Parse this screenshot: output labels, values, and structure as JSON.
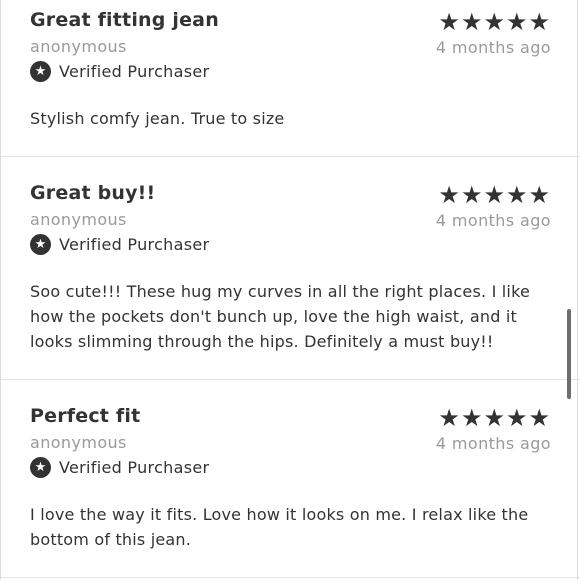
{
  "reviews": [
    {
      "title": "Great fitting jean",
      "stars": "★★★★★",
      "rating": 5,
      "author": "anonymous",
      "date": "4 months ago",
      "verified": "Verified Purchaser",
      "body": "Stylish comfy jean. True to size"
    },
    {
      "title": "Great buy!!",
      "stars": "★★★★★",
      "rating": 5,
      "author": "anonymous",
      "date": "4 months ago",
      "verified": "Verified Purchaser",
      "body": "Soo cute!!! These hug my curves in all the right places. I like how the pockets don't bunch up, love the high waist, and it looks slimming through the hips. Definitely a must buy!!"
    },
    {
      "title": "Perfect fit",
      "stars": "★★★★★",
      "rating": 5,
      "author": "anonymous",
      "date": "4 months ago",
      "verified": "Verified Purchaser",
      "body": "I love the way it fits. Love how it looks on me. I relax like the bottom of this jean."
    }
  ],
  "icons": {
    "verified_badge": "star-icon",
    "rating": "star-icon"
  },
  "colors": {
    "text": "#333333",
    "muted": "#9a9a9a",
    "divider": "#e3e3e3"
  }
}
